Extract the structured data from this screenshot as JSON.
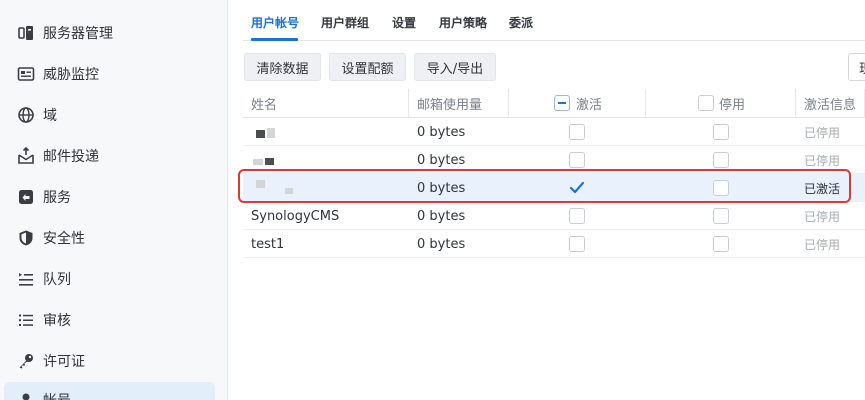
{
  "sidebar": {
    "items": [
      {
        "label": "服务器管理",
        "icon": "server-icon"
      },
      {
        "label": "威胁监控",
        "icon": "monitor-icon"
      },
      {
        "label": "域",
        "icon": "globe-icon"
      },
      {
        "label": "邮件投递",
        "icon": "mail-delivery-icon"
      },
      {
        "label": "服务",
        "icon": "services-icon"
      },
      {
        "label": "安全性",
        "icon": "shield-icon"
      },
      {
        "label": "队列",
        "icon": "queue-icon"
      },
      {
        "label": "审核",
        "icon": "audit-list-icon"
      },
      {
        "label": "许可证",
        "icon": "key-icon"
      },
      {
        "label": "帐号",
        "icon": "user-icon",
        "active": true
      }
    ]
  },
  "tabs": [
    {
      "label": "用户帐号",
      "active": true
    },
    {
      "label": "用户群组"
    },
    {
      "label": "设置"
    },
    {
      "label": "用户策略"
    },
    {
      "label": "委派"
    }
  ],
  "toolbar": {
    "clear_label": "清除数据",
    "quota_label": "设置配额",
    "import_export_label": "导入/导出",
    "right_partial_label": "现"
  },
  "table": {
    "headers": {
      "name": "姓名",
      "mailbox_usage": "邮箱使用量",
      "active": "激活",
      "disabled": "停用",
      "activation_info": "激活信息"
    },
    "rows": [
      {
        "name": "",
        "usage": "0 bytes",
        "active": false,
        "disabled": false,
        "status": "已停用"
      },
      {
        "name": "",
        "usage": "0 bytes",
        "active": false,
        "disabled": false,
        "status": "已停用"
      },
      {
        "name": "",
        "usage": "0 bytes",
        "active": true,
        "disabled": false,
        "status": "已激活",
        "selected": true
      },
      {
        "name": "SynologyCMS",
        "usage": "0 bytes",
        "active": false,
        "disabled": false,
        "status": "已停用"
      },
      {
        "name": "test1",
        "usage": "0 bytes",
        "active": false,
        "disabled": false,
        "status": "已停用"
      }
    ]
  },
  "colors": {
    "accent": "#1a73d9",
    "highlight": "#d73d2c"
  }
}
